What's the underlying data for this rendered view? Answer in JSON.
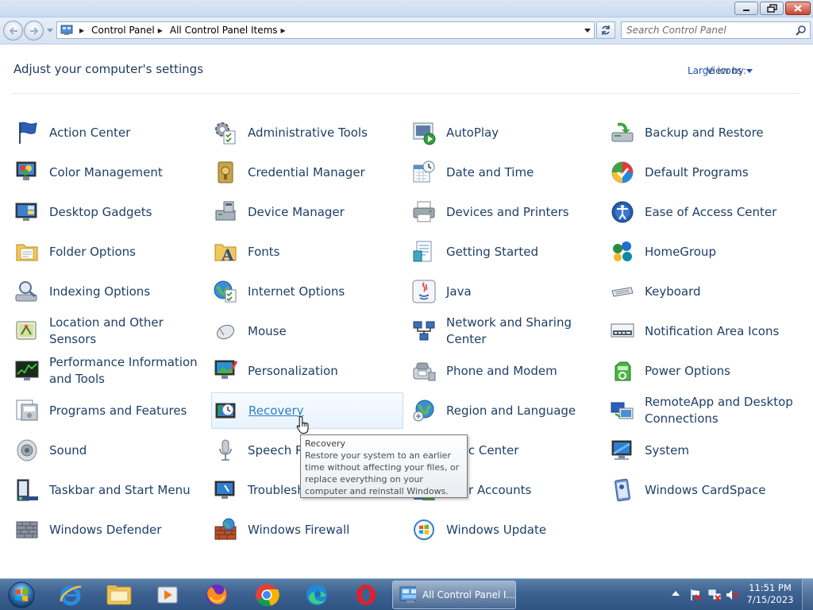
{
  "window": {
    "minimize_icon": "minimize-icon",
    "maximize_icon": "restore-icon",
    "close_icon": "close-icon"
  },
  "address": {
    "breadcrumb": [
      "Control Panel",
      "All Control Panel Items"
    ],
    "search_placeholder": "Search Control Panel"
  },
  "header": {
    "title": "Adjust your computer's settings",
    "view_by_label": "View by:",
    "view_by_value": "Large icons"
  },
  "items": [
    {
      "label": "Action Center",
      "icon": "flag-icon"
    },
    {
      "label": "Administrative Tools",
      "icon": "admin-tools-icon"
    },
    {
      "label": "AutoPlay",
      "icon": "autoplay-icon"
    },
    {
      "label": "Backup and Restore",
      "icon": "backup-icon"
    },
    {
      "label": "Color Management",
      "icon": "color-management-icon"
    },
    {
      "label": "Credential Manager",
      "icon": "credential-vault-icon"
    },
    {
      "label": "Date and Time",
      "icon": "calendar-clock-icon"
    },
    {
      "label": "Default Programs",
      "icon": "default-programs-icon"
    },
    {
      "label": "Desktop Gadgets",
      "icon": "gadgets-icon"
    },
    {
      "label": "Device Manager",
      "icon": "device-manager-icon"
    },
    {
      "label": "Devices and Printers",
      "icon": "printer-icon"
    },
    {
      "label": "Ease of Access Center",
      "icon": "ease-of-access-icon"
    },
    {
      "label": "Folder Options",
      "icon": "folder-icon"
    },
    {
      "label": "Fonts",
      "icon": "fonts-folder-icon"
    },
    {
      "label": "Getting Started",
      "icon": "getting-started-icon"
    },
    {
      "label": "HomeGroup",
      "icon": "homegroup-icon"
    },
    {
      "label": "Indexing Options",
      "icon": "indexing-icon"
    },
    {
      "label": "Internet Options",
      "icon": "internet-options-icon"
    },
    {
      "label": "Java",
      "icon": "java-icon"
    },
    {
      "label": "Keyboard",
      "icon": "keyboard-icon"
    },
    {
      "label": "Location and Other Sensors",
      "icon": "sensors-icon"
    },
    {
      "label": "Mouse",
      "icon": "mouse-icon"
    },
    {
      "label": "Network and Sharing Center",
      "icon": "network-icon"
    },
    {
      "label": "Notification Area Icons",
      "icon": "notification-area-icon"
    },
    {
      "label": "Performance Information and Tools",
      "icon": "performance-icon"
    },
    {
      "label": "Personalization",
      "icon": "personalization-icon"
    },
    {
      "label": "Phone and Modem",
      "icon": "phone-modem-icon"
    },
    {
      "label": "Power Options",
      "icon": "power-icon"
    },
    {
      "label": "Programs and Features",
      "icon": "programs-icon"
    },
    {
      "label": "Recovery",
      "icon": "recovery-icon"
    },
    {
      "label": "Region and Language",
      "icon": "globe-icon"
    },
    {
      "label": "RemoteApp and Desktop Connections",
      "icon": "remoteapp-icon"
    },
    {
      "label": "Sound",
      "icon": "speaker-icon"
    },
    {
      "label": "Speech Recognition",
      "icon": "microphone-icon"
    },
    {
      "label": "Sync Center",
      "icon": "sync-icon"
    },
    {
      "label": "System",
      "icon": "system-icon"
    },
    {
      "label": "Taskbar and Start Menu",
      "icon": "taskbar-icon"
    },
    {
      "label": "Troubleshooting",
      "icon": "troubleshooting-icon"
    },
    {
      "label": "User Accounts",
      "icon": "user-accounts-icon"
    },
    {
      "label": "Windows CardSpace",
      "icon": "cardspace-icon"
    },
    {
      "label": "Windows Defender",
      "icon": "defender-icon"
    },
    {
      "label": "Windows Firewall",
      "icon": "firewall-icon"
    },
    {
      "label": "Windows Update",
      "icon": "windows-update-icon"
    }
  ],
  "tooltip": {
    "title": "Recovery",
    "body": "Restore your system to an earlier time without affecting your files, or replace everything on your computer and reinstall Windows."
  },
  "taskbar": {
    "apps": [
      "internet-explorer-icon",
      "file-explorer-icon",
      "media-player-icon",
      "firefox-icon",
      "chrome-icon",
      "edge-icon",
      "opera-icon"
    ],
    "active_window_label": "All Control Panel I...",
    "clock_time": "11:51 PM",
    "clock_date": "7/15/2023"
  },
  "colors": {
    "link_text": "#1e3f66",
    "title_text": "#1e395b",
    "view_by_value": "#1f52b3",
    "taskbar": "#3d6291"
  }
}
